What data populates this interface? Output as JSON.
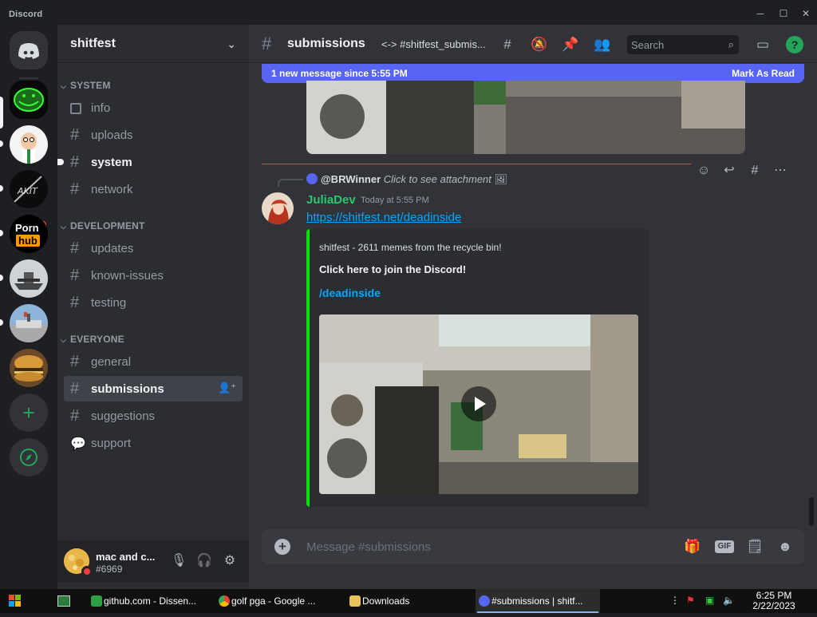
{
  "window": {
    "title": "Discord"
  },
  "server": {
    "name": "shitfest"
  },
  "guilds": [
    {
      "name": "trollface-server"
    },
    {
      "name": "peter-server"
    },
    {
      "name": "akit-server",
      "mentions": "1"
    },
    {
      "name": "hub-server",
      "icon_text_top": "Porn",
      "icon_text_bottom": "hub"
    },
    {
      "name": "aircraft-server"
    },
    {
      "name": "building-server"
    },
    {
      "name": "burger-server"
    }
  ],
  "categories": {
    "system": "SYSTEM",
    "development": "DEVELOPMENT",
    "everyone": "EVERYONE"
  },
  "channels": {
    "info": "info",
    "uploads": "uploads",
    "system": "system",
    "network": "network",
    "updates": "updates",
    "known_issues": "known-issues",
    "testing": "testing",
    "general": "general",
    "submissions": "submissions",
    "suggestions": "suggestions",
    "support": "support"
  },
  "user": {
    "name": "mac and c...",
    "tag": "#6969",
    "status_color": "#f23f43"
  },
  "header": {
    "channel": "submissions",
    "topic": "<-> #shitfest_submis...",
    "search_placeholder": "Search"
  },
  "new_messages": {
    "text": "1 new message since 5:55 PM",
    "action": "Mark As Read"
  },
  "message": {
    "reply_user": "@BRWinner",
    "reply_text": "Click to see attachment",
    "author": "JuliaDev",
    "author_color": "#2dc770",
    "timestamp": "Today at 5:55 PM",
    "link": "https://shitfest.net/deadinside",
    "embed": {
      "provider": "shitfest - 2611 memes from the recycle bin!",
      "title": "Click here to join the Discord!",
      "description": "/deadinside",
      "border_color": "#00e500"
    }
  },
  "composer": {
    "placeholder": "Message #submissions",
    "gif_label": "GIF"
  },
  "taskbar": {
    "items": [
      {
        "label": "github.com - Dissen...",
        "icon_color": "#2ea043"
      },
      {
        "label": "golf pga - Google ...",
        "icon_color": "#fbbc05"
      },
      {
        "label": "Downloads",
        "icon_color": "#e8c25a"
      },
      {
        "label": "#submissions | shitf...",
        "icon_color": "#5865f2"
      }
    ],
    "time": "6:25 PM",
    "date": "2/22/2023"
  },
  "colors": {
    "accent": "#5865f2",
    "link": "#00a8fc",
    "unread_line": "#f23f43"
  }
}
